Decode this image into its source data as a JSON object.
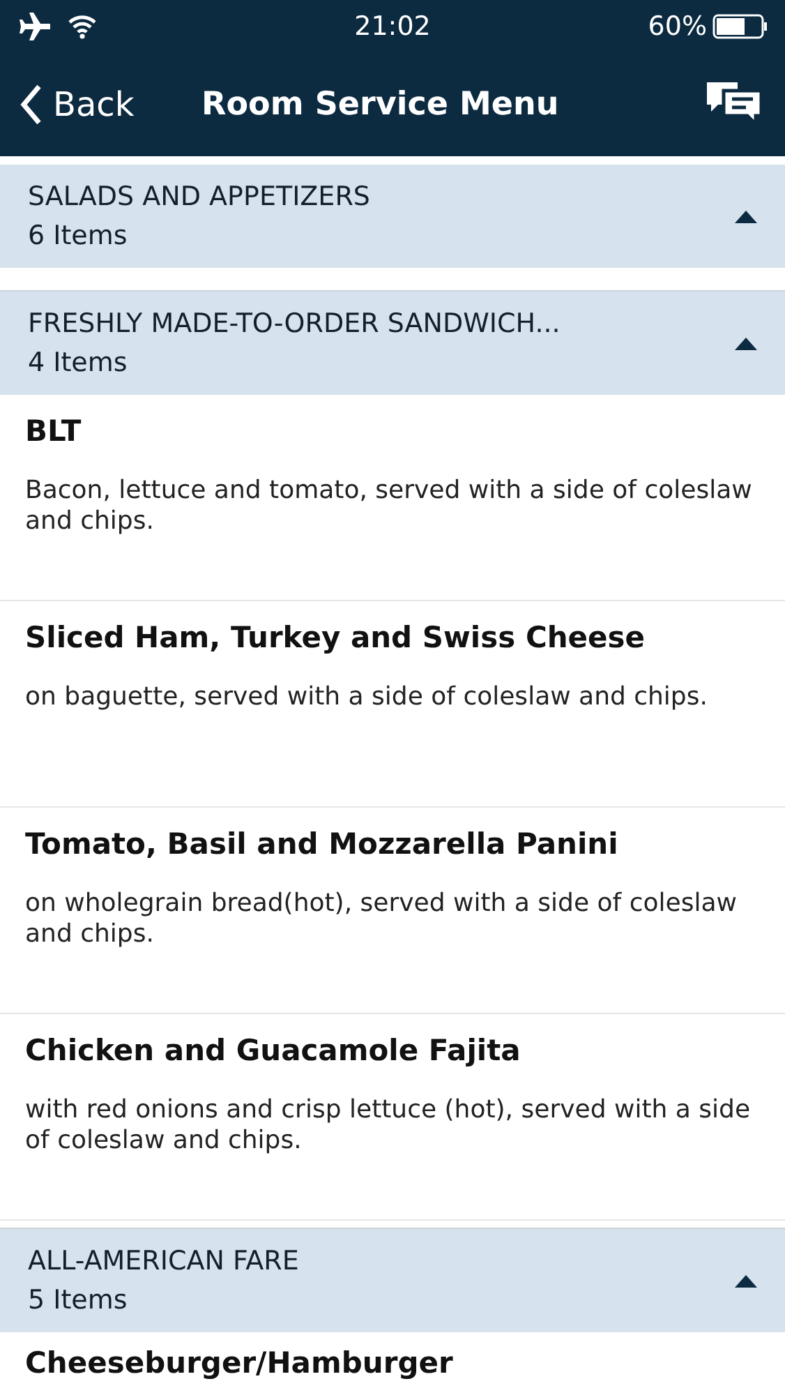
{
  "status_bar": {
    "time": "21:02",
    "battery": "60%"
  },
  "nav": {
    "back": "Back",
    "title": "Room Service Menu"
  },
  "sections": [
    {
      "title": "SALADS AND APPETIZERS",
      "count": "6 Items"
    },
    {
      "title": "FRESHLY MADE-TO-ORDER SANDWICH...",
      "count": "4 Items",
      "items": [
        {
          "name": "BLT",
          "description": "Bacon, lettuce and tomato, served with a side of coleslaw and chips."
        },
        {
          "name": "Sliced Ham, Turkey and Swiss Cheese",
          "description": "on baguette, served with a side of coleslaw and chips."
        },
        {
          "name": "Tomato, Basil and Mozzarella Panini",
          "description": "on wholegrain bread(hot), served with a side of coleslaw and chips."
        },
        {
          "name": "Chicken and Guacamole Fajita",
          "description": "with red onions and crisp lettuce (hot), served with a side of coleslaw and chips."
        }
      ]
    },
    {
      "title": "ALL-AMERICAN FARE",
      "count": "5 Items",
      "items": [
        {
          "name": "Cheeseburger/Hamburger"
        }
      ]
    }
  ]
}
